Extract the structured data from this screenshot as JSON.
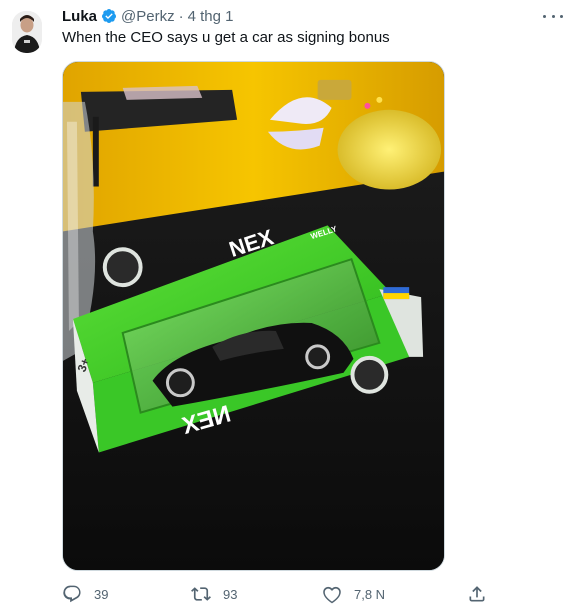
{
  "tweet": {
    "author_name": "Luka",
    "handle": "@Perkz",
    "separator": "·",
    "time": "4 thg 1",
    "text": "When the CEO says u get a car as signing bonus",
    "verified_color": "#1d9bf0",
    "media_description_icon": "photo-of-boxed-toy-car"
  },
  "actions": {
    "reply_count": "39",
    "retweet_count": "93",
    "like_count": "7,8 N",
    "icons": [
      "reply-icon",
      "retweet-icon",
      "like-icon",
      "share-icon"
    ]
  },
  "photo": {
    "box_brand": "NEX",
    "box_maker": "WELLY",
    "age_label": "3+",
    "colors": {
      "box_green": "#3dd22a",
      "wall_yellow": "#f2c000",
      "table_black": "#121212"
    }
  }
}
